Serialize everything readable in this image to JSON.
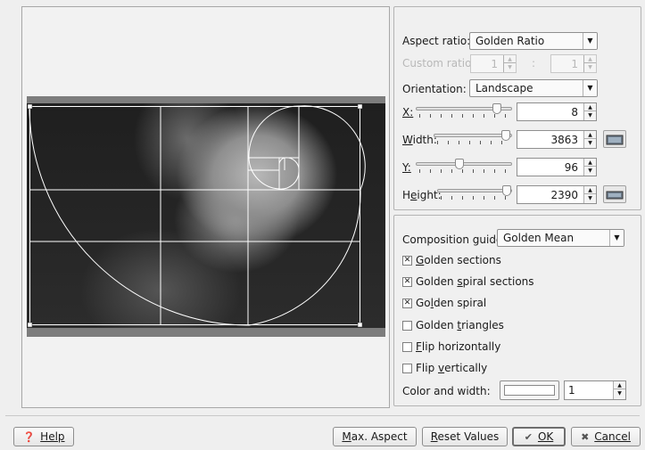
{
  "settings": {
    "aspect_ratio": {
      "label": "Aspect ratio:",
      "value": "Golden Ratio"
    },
    "custom_ratio": {
      "label": "Custom ratio:",
      "value1": "1",
      "separator": ":",
      "value2": "1"
    },
    "orientation": {
      "label": "Orientation:",
      "value": "Landscape"
    },
    "x": {
      "label": "X:",
      "value": "8",
      "slider_level": 0.88
    },
    "width": {
      "label": "Width:",
      "value": "3863",
      "slider_level": 0.97
    },
    "y": {
      "label": "Y:",
      "value": "96",
      "slider_level": 0.45
    },
    "height": {
      "label": "Height:",
      "value": "2390",
      "slider_level": 0.98
    }
  },
  "composition": {
    "guide": {
      "label": "Composition guide:",
      "value": "Golden Mean"
    },
    "options": [
      {
        "label": "Golden sections",
        "checked": true
      },
      {
        "label": "Golden spiral sections",
        "checked": true
      },
      {
        "label": "Golden spiral",
        "checked": true
      },
      {
        "label": "Golden triangles",
        "checked": false
      },
      {
        "label": "Flip horizontally",
        "checked": false
      },
      {
        "label": "Flip vertically",
        "checked": false
      }
    ],
    "color_width": {
      "label": "Color and width:",
      "color": "#ffffff",
      "width": "1"
    }
  },
  "buttons": {
    "help": "Help",
    "max_aspect": "Max. Aspect",
    "reset": "Reset Values",
    "ok": "OK",
    "cancel": "Cancel"
  },
  "icons": {
    "help": "help-icon",
    "ok": "checkmark-icon",
    "cancel": "cancel-icon"
  }
}
